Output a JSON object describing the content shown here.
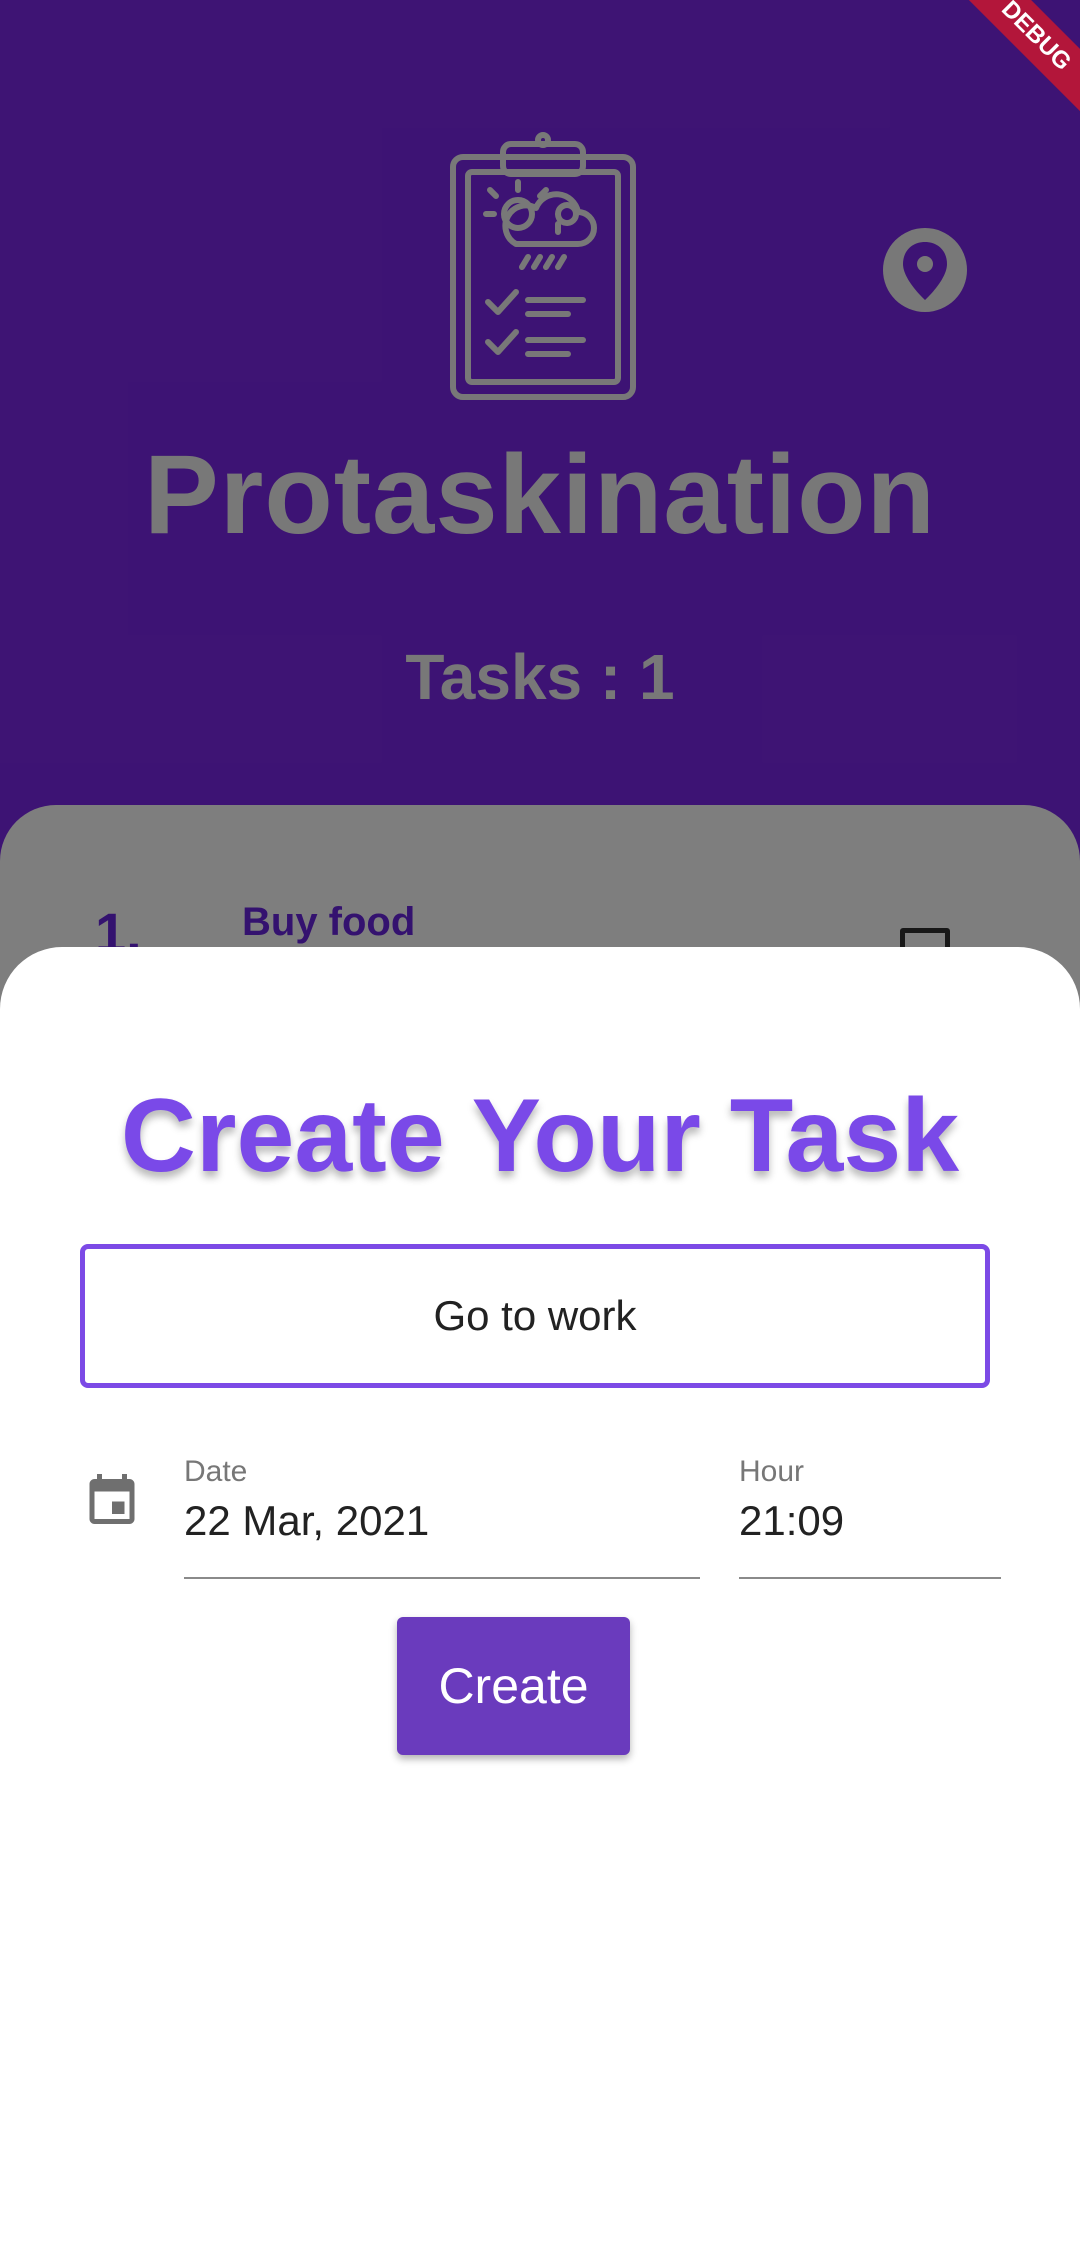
{
  "app": {
    "title": "Protaskination",
    "task_count_text": "Tasks : 1",
    "debug_banner": "DEBUG",
    "brand_color": "#6a22c8"
  },
  "icons": {
    "logo": "clipboard-weather-checklist-icon",
    "location": "location-pin-icon",
    "calendar": "calendar-icon"
  },
  "task_list": [
    {
      "number": "1.",
      "title": "Buy food"
    }
  ],
  "sheet": {
    "title": "Create Your Task",
    "task_input_value": "Go to work",
    "date_label": "Date",
    "date_value": "22 Mar, 2021",
    "hour_label": "Hour",
    "hour_value": "21:09",
    "create_button_label": "Create",
    "accent_color": "#7a49e8"
  }
}
